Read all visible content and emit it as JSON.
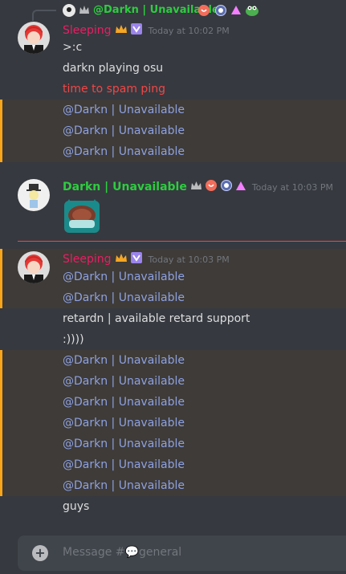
{
  "reply": {
    "author": "@Darkn | Unavailable"
  },
  "group1": {
    "author": "Sleeping",
    "timestamp": "Today at 10:02 PM",
    "messages": [
      ">:c",
      "darkn playing osu",
      "time to spam ping",
      "@Darkn | Unavailable",
      "@Darkn | Unavailable",
      "@Darkn | Unavailable"
    ]
  },
  "group2": {
    "author": "Darkn | Unavailable",
    "timestamp": "Today at 10:03 PM"
  },
  "group3": {
    "author": "Sleeping",
    "timestamp": "Today at 10:03 PM",
    "messages": [
      "@Darkn | Unavailable",
      "@Darkn | Unavailable",
      "retardn | available retard support",
      ":))))",
      "@Darkn | Unavailable",
      "@Darkn | Unavailable",
      "@Darkn | Unavailable",
      "@Darkn | Unavailable",
      "@Darkn | Unavailable",
      "@Darkn | Unavailable",
      "@Darkn | Unavailable",
      "guys"
    ]
  },
  "composer": {
    "placeholder": "Message #💬general",
    "plus_label": "+"
  },
  "colors": {
    "background": "#36393f",
    "mention_highlight": "#3e3b38",
    "mention_bar": "#faa61a",
    "mention_text": "#8ea1e1",
    "sleeping_name": "#e91e63",
    "darkn_name": "#2ecc40",
    "new_messages_divider": "#f04747"
  }
}
